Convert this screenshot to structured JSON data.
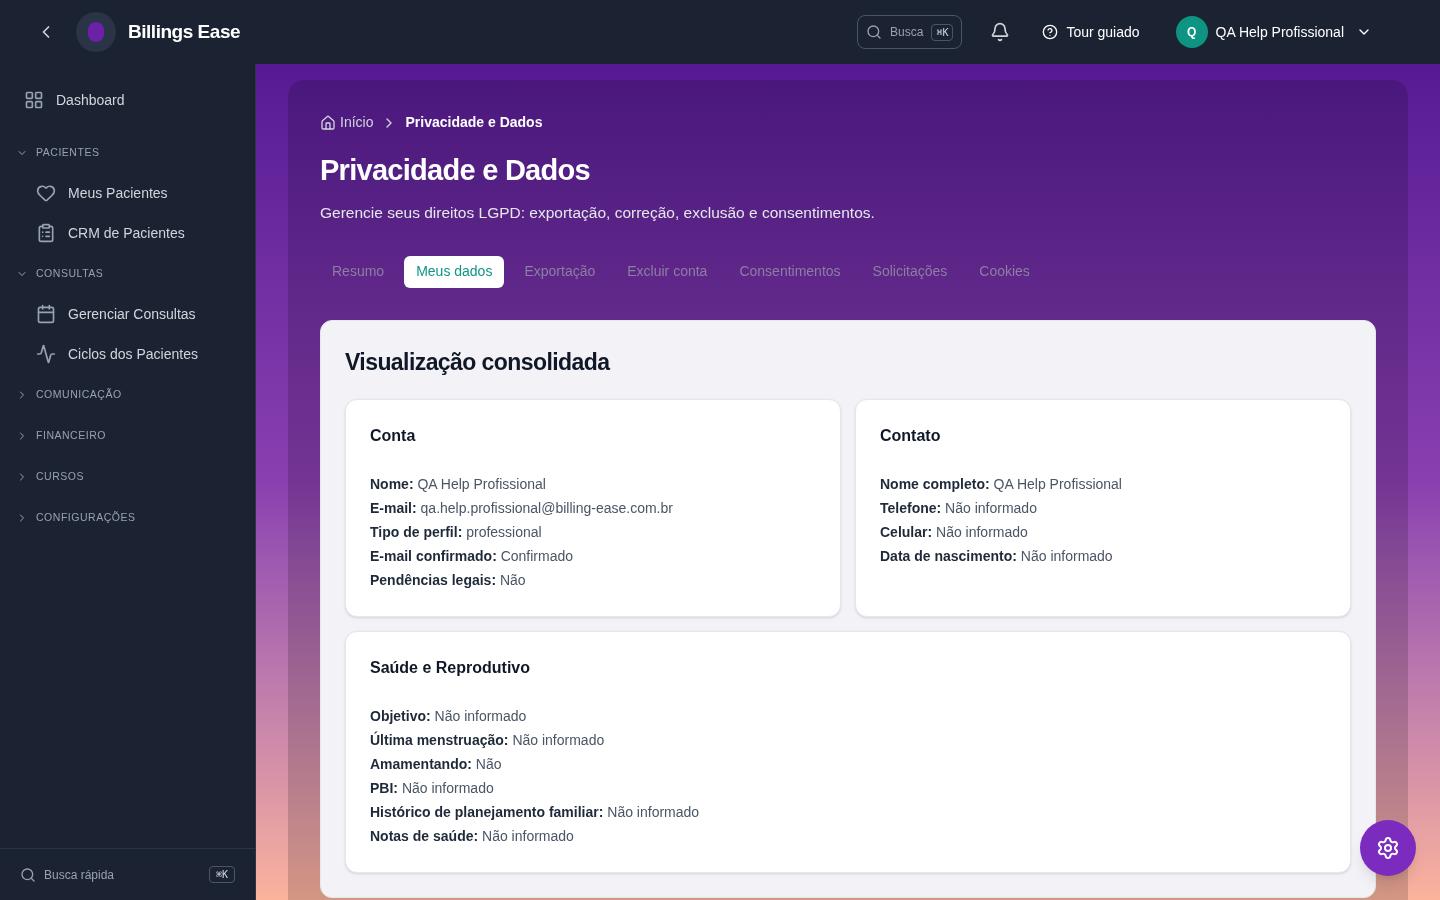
{
  "header": {
    "brand": "Billings Ease",
    "search": {
      "placeholder": "Busca",
      "shortcut": "⌘K"
    },
    "tour": "Tour guiado",
    "user": {
      "initial": "Q",
      "name": "QA Help Profissional"
    }
  },
  "sidebar": {
    "dashboard": "Dashboard",
    "groups": [
      {
        "label": "PACIENTES",
        "expanded": true,
        "items": [
          {
            "label": "Meus Pacientes"
          },
          {
            "label": "CRM de Pacientes"
          }
        ]
      },
      {
        "label": "CONSULTAS",
        "expanded": true,
        "items": [
          {
            "label": "Gerenciar Consultas"
          },
          {
            "label": "Ciclos dos Pacientes"
          }
        ]
      },
      {
        "label": "COMUNICAÇÃO",
        "expanded": false
      },
      {
        "label": "FINANCEIRO",
        "expanded": false
      },
      {
        "label": "CURSOS",
        "expanded": false
      },
      {
        "label": "CONFIGURAÇÕES",
        "expanded": false
      }
    ],
    "quick_search": {
      "placeholder": "Busca rápida",
      "shortcut": "⌘K"
    }
  },
  "breadcrumb": [
    {
      "label": "Início"
    },
    {
      "label": "Privacidade e Dados"
    }
  ],
  "title": "Privacidade e Dados",
  "subtitle": "Gerencie seus direitos LGPD: exportação, correção, exclusão e consentimentos.",
  "tabs": [
    {
      "label": "Resumo",
      "selected": false
    },
    {
      "label": "Meus dados",
      "selected": true
    },
    {
      "label": "Exportação",
      "selected": false
    },
    {
      "label": "Excluir conta",
      "selected": false
    },
    {
      "label": "Consentimentos",
      "selected": false
    },
    {
      "label": "Solicitações",
      "selected": false
    },
    {
      "label": "Cookies",
      "selected": false
    }
  ],
  "section": {
    "title": "Visualização consolidada",
    "cards": [
      {
        "title": "Conta",
        "rows": [
          {
            "label": "Nome:",
            "value": "QA Help Profissional"
          },
          {
            "label": "E-mail:",
            "value": "qa.help.profissional@billing-ease.com.br"
          },
          {
            "label": "Tipo de perfil:",
            "value": "professional"
          },
          {
            "label": "E-mail confirmado:",
            "value": "Confirmado"
          },
          {
            "label": "Pendências legais:",
            "value": "Não"
          }
        ]
      },
      {
        "title": "Contato",
        "rows": [
          {
            "label": "Nome completo:",
            "value": "QA Help Profissional"
          },
          {
            "label": "Telefone:",
            "value": "Não informado"
          },
          {
            "label": "Celular:",
            "value": "Não informado"
          },
          {
            "label": "Data de nascimento:",
            "value": "Não informado"
          }
        ]
      },
      {
        "title": "Saúde e Reprodutivo",
        "rows": [
          {
            "label": "Objetivo:",
            "value": "Não informado"
          },
          {
            "label": "Última menstruação:",
            "value": "Não informado"
          },
          {
            "label": "Amamentando:",
            "value": "Não"
          },
          {
            "label": "PBI:",
            "value": "Não informado"
          },
          {
            "label": "Histórico de planejamento familiar:",
            "value": "Não informado"
          },
          {
            "label": "Notas de saúde:",
            "value": "Não informado"
          }
        ]
      }
    ]
  }
}
